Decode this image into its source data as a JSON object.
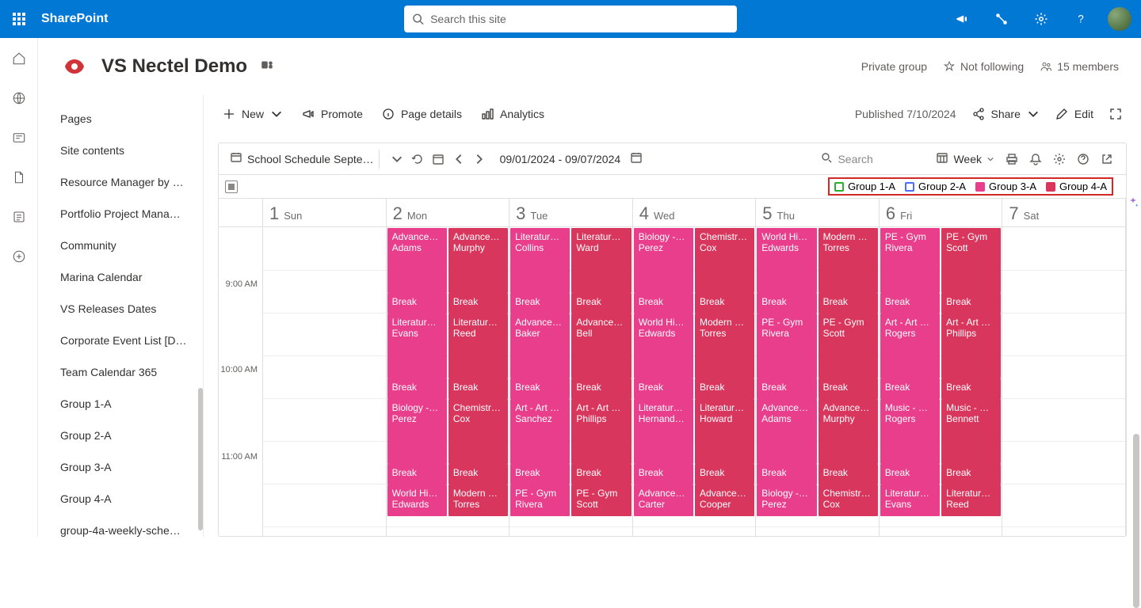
{
  "suite": {
    "brand": "SharePoint",
    "search_placeholder": "Search this site"
  },
  "site": {
    "title": "VS Nectel Demo",
    "privacy": "Private group",
    "follow": "Not following",
    "members": "15 members"
  },
  "nav": {
    "items": [
      "Pages",
      "Site contents",
      "Resource Manager by …",
      "Portfolio Project Mana…",
      "Community",
      "Marina Calendar",
      "VS Releases Dates",
      "Corporate Event List [D…",
      "Team Calendar 365",
      "Group 1-A",
      "Group 2-A",
      "Group 3-A",
      "Group 4-A",
      "group-4a-weekly-sche…"
    ]
  },
  "cmd": {
    "new": "New",
    "promote": "Promote",
    "page_details": "Page details",
    "analytics": "Analytics",
    "published": "Published 7/10/2024",
    "share": "Share",
    "edit": "Edit"
  },
  "calendar": {
    "source": "School Schedule Septe…",
    "range": "09/01/2024 - 09/07/2024",
    "search_placeholder": "Search",
    "view": "Week",
    "legend": [
      {
        "label": "Group 1-A",
        "color": "#2bb02b",
        "fill": "transparent"
      },
      {
        "label": "Group 2-A",
        "color": "#4a6cff",
        "fill": "transparent"
      },
      {
        "label": "Group 3-A",
        "color": "#e83e8c",
        "fill": "#e83e8c"
      },
      {
        "label": "Group 4-A",
        "color": "#d9365d",
        "fill": "#d9365d"
      }
    ],
    "days": [
      {
        "num": "1",
        "label": "Sun"
      },
      {
        "num": "2",
        "label": "Mon"
      },
      {
        "num": "3",
        "label": "Tue"
      },
      {
        "num": "4",
        "label": "Wed"
      },
      {
        "num": "5",
        "label": "Thu"
      },
      {
        "num": "6",
        "label": "Fri"
      },
      {
        "num": "7",
        "label": "Sat"
      }
    ],
    "times": [
      "9:00 AM",
      "10:00 AM",
      "11:00 AM"
    ],
    "break": "Break",
    "rows": [
      [
        {
          "a": {
            "t": "Advance…",
            "s": "Adams"
          },
          "b": {
            "t": "Advance…",
            "s": "Murphy"
          }
        },
        {
          "a": {
            "t": "Literatur…",
            "s": "Collins"
          },
          "b": {
            "t": "Literatur…",
            "s": "Ward"
          }
        },
        {
          "a": {
            "t": "Biology -…",
            "s": "Perez"
          },
          "b": {
            "t": "Chemistr…",
            "s": "Cox"
          }
        },
        {
          "a": {
            "t": "World Hi…",
            "s": "Edwards"
          },
          "b": {
            "t": "Modern …",
            "s": "Torres"
          }
        },
        {
          "a": {
            "t": "PE - Gym",
            "s": "Rivera"
          },
          "b": {
            "t": "PE - Gym",
            "s": "Scott"
          }
        }
      ],
      [
        {
          "a": {
            "t": "Literatur…",
            "s": "Evans"
          },
          "b": {
            "t": "Literatur…",
            "s": "Reed"
          }
        },
        {
          "a": {
            "t": "Advance…",
            "s": "Baker"
          },
          "b": {
            "t": "Advance…",
            "s": "Bell"
          }
        },
        {
          "a": {
            "t": "World Hi…",
            "s": "Edwards"
          },
          "b": {
            "t": "Modern …",
            "s": "Torres"
          }
        },
        {
          "a": {
            "t": "PE - Gym",
            "s": "Rivera"
          },
          "b": {
            "t": "PE - Gym",
            "s": "Scott"
          }
        },
        {
          "a": {
            "t": "Art - Art …",
            "s": "Rogers"
          },
          "b": {
            "t": "Art - Art …",
            "s": "Phillips"
          }
        }
      ],
      [
        {
          "a": {
            "t": "Biology -…",
            "s": "Perez"
          },
          "b": {
            "t": "Chemistr…",
            "s": "Cox"
          }
        },
        {
          "a": {
            "t": "Art - Art …",
            "s": "Sanchez"
          },
          "b": {
            "t": "Art - Art …",
            "s": "Phillips"
          }
        },
        {
          "a": {
            "t": "Literatur…",
            "s": "Hernand…"
          },
          "b": {
            "t": "Literatur…",
            "s": "Howard"
          }
        },
        {
          "a": {
            "t": "Advance…",
            "s": "Adams"
          },
          "b": {
            "t": "Advance…",
            "s": "Murphy"
          }
        },
        {
          "a": {
            "t": "Music - …",
            "s": "Rogers"
          },
          "b": {
            "t": "Music - …",
            "s": "Bennett"
          }
        }
      ],
      [
        {
          "a": {
            "t": "World Hi…",
            "s": "Edwards"
          },
          "b": {
            "t": "Modern …",
            "s": "Torres"
          }
        },
        {
          "a": {
            "t": "PE - Gym",
            "s": "Rivera"
          },
          "b": {
            "t": "PE - Gym",
            "s": "Scott"
          }
        },
        {
          "a": {
            "t": "Advance…",
            "s": "Carter"
          },
          "b": {
            "t": "Advance…",
            "s": "Cooper"
          }
        },
        {
          "a": {
            "t": "Biology -…",
            "s": "Perez"
          },
          "b": {
            "t": "Chemistr…",
            "s": "Cox"
          }
        },
        {
          "a": {
            "t": "Literatur…",
            "s": "Evans"
          },
          "b": {
            "t": "Literatur…",
            "s": "Reed"
          }
        }
      ]
    ]
  }
}
